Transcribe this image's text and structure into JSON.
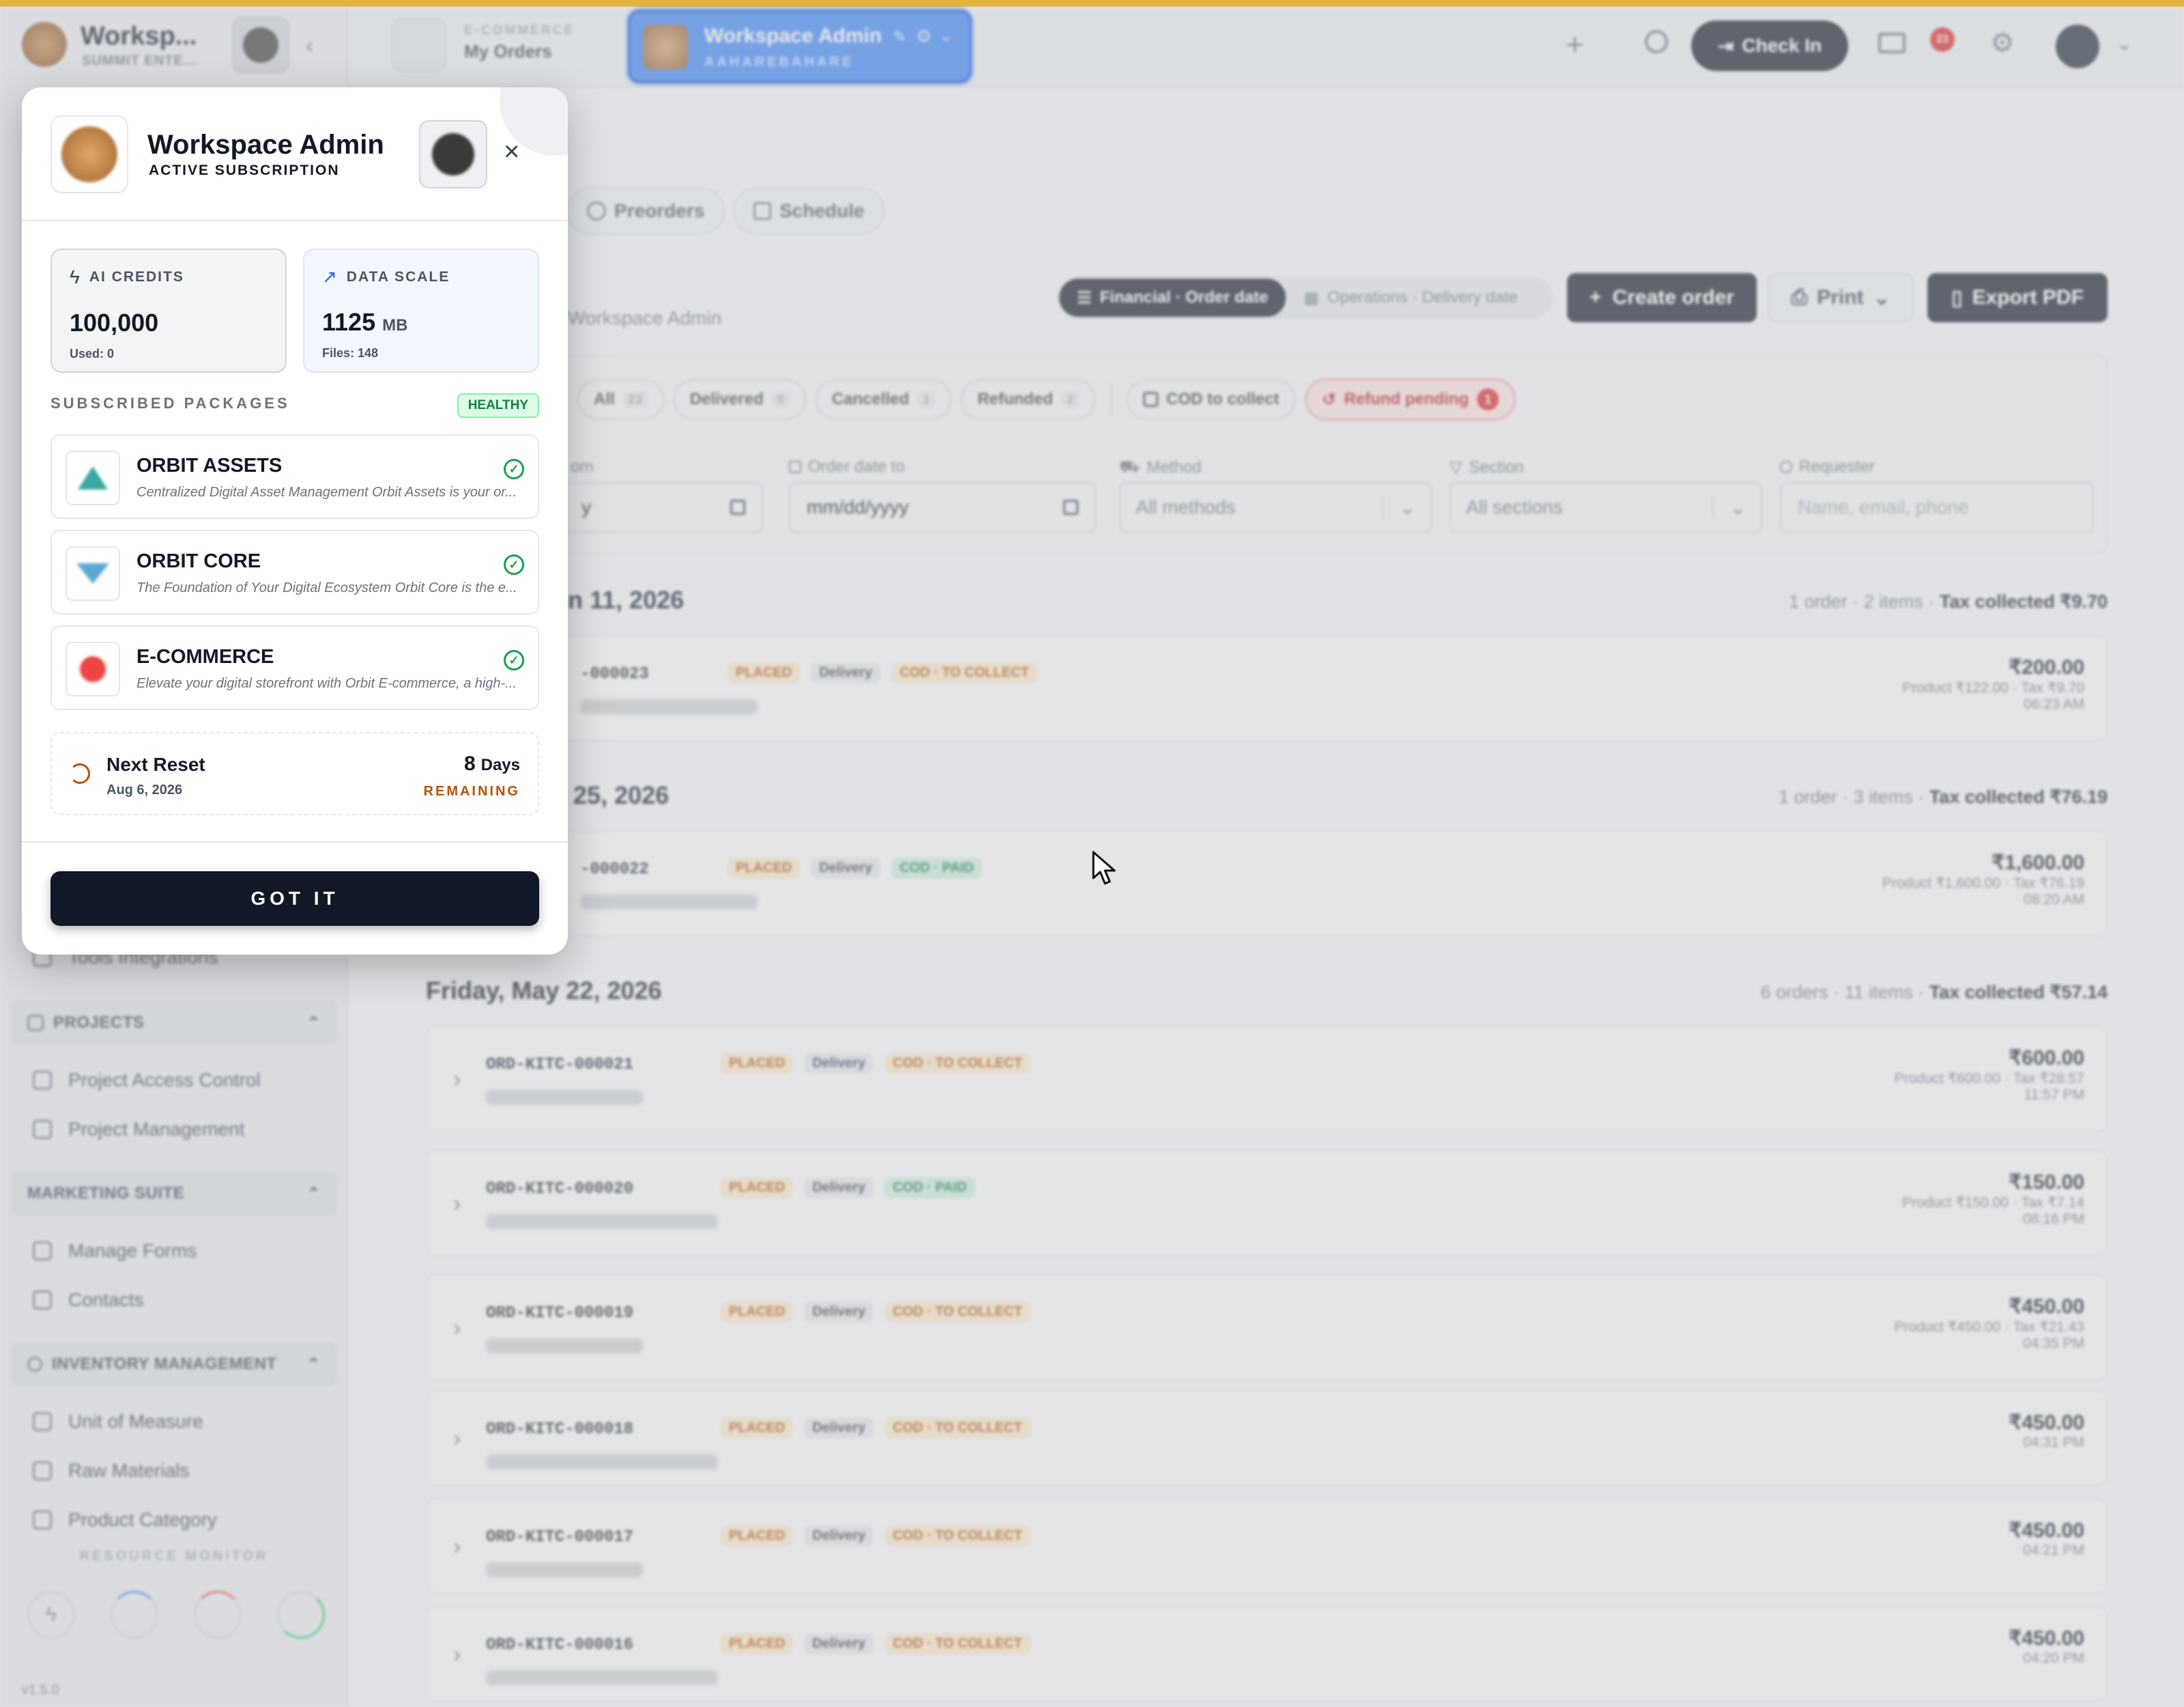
{
  "header": {
    "workspace_name": "Worksp...",
    "workspace_sub": "SUMMIT ENTE...",
    "module_label": "E-COMMERCE",
    "module_title": "My Orders",
    "active_tab_title": "Workspace Admin",
    "active_tab_sub": "AAHAREBAHARE",
    "checkin_label": "Check In",
    "notif_count": "23"
  },
  "tabs": [
    {
      "label": "Preorders"
    },
    {
      "label": "Schedule"
    }
  ],
  "toolbar": {
    "breadcrumb_tail": "Workspace Admin",
    "financial_label": "Financial · Order date",
    "operations_label": "Operations · Delivery date",
    "create_label": "Create order",
    "print_label": "Print",
    "export_label": "Export PDF"
  },
  "filters": {
    "chips": [
      {
        "label": "All",
        "count": "23"
      },
      {
        "label": "Delivered",
        "count": "0"
      },
      {
        "label": "Cancelled",
        "count": "1"
      },
      {
        "label": "Refunded",
        "count": "2"
      }
    ],
    "cod_label": "COD to collect",
    "refund_label": "Refund pending",
    "refund_count": "1",
    "from_label": "om",
    "from_value": "y",
    "to_label": "Order date to",
    "to_placeholder": "mm/dd/yyyy",
    "method_label": "Method",
    "method_value": "All methods",
    "section_label": "Section",
    "section_value": "All sections",
    "requester_label": "Requester",
    "requester_placeholder": "Name, email, phone"
  },
  "groups": [
    {
      "title": "un 11, 2026",
      "meta": "1 order · 2 items · ",
      "tax": "Tax collected ₹9.70",
      "orders": [
        {
          "id": "-000023",
          "placed": "PLACED",
          "delivery": "Delivery",
          "cod": "COD · TO COLLECT",
          "cod_type": "collect",
          "amount": "₹200.00",
          "detail": "Product ₹122.00 · Tax ₹9.70",
          "time": "06:23 AM"
        }
      ]
    },
    {
      "title": "y 25, 2026",
      "meta": "1 order · 3 items · ",
      "tax": "Tax collected ₹76.19",
      "orders": [
        {
          "id": "-000022",
          "placed": "PLACED",
          "delivery": "Delivery",
          "cod": "COD · PAID",
          "cod_type": "paid",
          "amount": "₹1,600.00",
          "detail": "Product ₹1,600.00 · Tax ₹76.19",
          "time": "08:20 AM"
        }
      ]
    },
    {
      "title": "Friday, May 22, 2026",
      "meta": "6 orders · 11 items · ",
      "tax": "Tax collected ₹57.14",
      "orders": [
        {
          "id": "ORD-KITC-000021",
          "placed": "PLACED",
          "delivery": "Delivery",
          "cod": "COD · TO COLLECT",
          "cod_type": "collect",
          "amount": "₹600.00",
          "detail": "Product ₹600.00 · Tax ₹28.57",
          "time": "11:57 PM"
        },
        {
          "id": "ORD-KITC-000020",
          "placed": "PLACED",
          "delivery": "Delivery",
          "cod": "COD · PAID",
          "cod_type": "paid",
          "amount": "₹150.00",
          "detail": "Product ₹150.00 · Tax ₹7.14",
          "time": "08:16 PM"
        },
        {
          "id": "ORD-KITC-000019",
          "placed": "PLACED",
          "delivery": "Delivery",
          "cod": "COD · TO COLLECT",
          "cod_type": "collect",
          "amount": "₹450.00",
          "detail": "Product ₹450.00 · Tax ₹21.43",
          "time": "04:35 PM"
        },
        {
          "id": "ORD-KITC-000018",
          "placed": "PLACED",
          "delivery": "Delivery",
          "cod": "COD · TO COLLECT",
          "cod_type": "collect",
          "amount": "₹450.00",
          "detail": "",
          "time": "04:31 PM"
        },
        {
          "id": "ORD-KITC-000017",
          "placed": "PLACED",
          "delivery": "Delivery",
          "cod": "COD · TO COLLECT",
          "cod_type": "collect",
          "amount": "₹450.00",
          "detail": "",
          "time": "04:21 PM"
        },
        {
          "id": "ORD-KITC-000016",
          "placed": "PLACED",
          "delivery": "Delivery",
          "cod": "COD · TO COLLECT",
          "cod_type": "collect",
          "amount": "₹450.00",
          "detail": "",
          "time": "04:20 PM"
        }
      ]
    }
  ],
  "sidebar": {
    "partial_item": "Tools Integrations",
    "sections": [
      {
        "title": "PROJECTS",
        "items": [
          "Project Access Control",
          "Project Management"
        ]
      },
      {
        "title": "MARKETING SUITE",
        "items": [
          "Manage Forms",
          "Contacts"
        ]
      },
      {
        "title": "INVENTORY MANAGEMENT",
        "items": [
          "Unit of Measure",
          "Raw Materials",
          "Product Category"
        ]
      }
    ],
    "monitor_label": "RESOURCE MONITOR",
    "version": "v1.5.0"
  },
  "modal": {
    "title": "Workspace Admin",
    "subtitle": "ACTIVE SUBSCRIPTION",
    "ai_credits_label": "AI CREDITS",
    "ai_credits_value": "100,000",
    "ai_credits_used": "Used: 0",
    "data_scale_label": "DATA SCALE",
    "data_scale_value": "1125",
    "data_scale_unit": "MB",
    "data_scale_files": "Files: 148",
    "packages_label": "SUBSCRIBED PACKAGES",
    "health_label": "HEALTHY",
    "packages": [
      {
        "name": "ORBIT ASSETS",
        "desc": "Centralized Digital Asset Management Orbit Assets is your or..."
      },
      {
        "name": "ORBIT CORE",
        "desc": "The Foundation of Your Digital Ecosystem Orbit Core is the e..."
      },
      {
        "name": "E-COMMERCE",
        "desc": "Elevate your digital storefront with Orbit E-commerce, a high-..."
      }
    ],
    "reset_title": "Next Reset",
    "reset_date": "Aug 6, 2026",
    "reset_days": "8",
    "reset_days_unit": "Days",
    "reset_remaining": "REMAINING",
    "got_it": "GOT IT"
  },
  "colors": {
    "accent": "#2563eb",
    "dark": "#111827",
    "healthy": "#16a34a",
    "warning": "#b45309",
    "refund": "#dc2626"
  }
}
